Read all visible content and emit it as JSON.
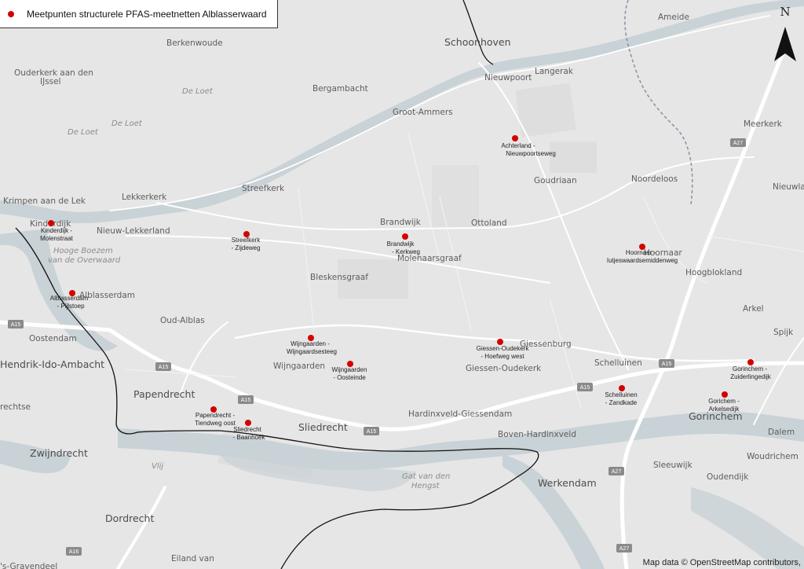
{
  "legend": {
    "label": "Meetpunten structurele PFAS-meetnetten Alblasserwaard",
    "marker_color": "#d40000"
  },
  "north_arrow": {
    "letter": "N"
  },
  "attribution": "Map data © OpenStreetMap contributors,",
  "colors": {
    "land": "#e6e6e6",
    "water": "#c9d2d6",
    "road": "#ffffff",
    "boundary": "#111111",
    "point": "#d40000"
  },
  "places": {
    "schoonhoven": "Schoonhoven",
    "ameide": "Ameide",
    "berkenwoude": "Berkenwoude",
    "ouderkerk": "Ouderkerk aan den",
    "ijssel": "IJssel",
    "bergambacht": "Bergambacht",
    "nieuwpoort": "Nieuwpoort",
    "langerak": "Langerak",
    "groot_ammers": "Groot-Ammers",
    "meerkerk": "Meerkerk",
    "goudriaan": "Goudriaan",
    "noordeloos": "Noordeloos",
    "nieuwland": "Nieuwland",
    "krimpen": "Krimpen aan de Lek",
    "lekkerkerk": "Lekkerkerk",
    "streefkerk": "Streefkerk",
    "kinderdijk": "Kinderdijk",
    "nieuw_lekkerland": "Nieuw-Lekkerland",
    "brandwijk": "Brandwijk",
    "ottoland": "Ottoland",
    "molenaarsgraaf": "Molenaarsgraaf",
    "hoornaar": "Hoornaar",
    "hoogblokland": "Hoogblokland",
    "bleskensgraaf": "Bleskensgraaf",
    "alblasserdam": "Alblasserdam",
    "oud_alblas": "Oud-Alblas",
    "oostendam": "Oostendam",
    "arkel": "Arkel",
    "spijk": "Spijk",
    "hendrik_ido": "Hendrik-Ido-Ambacht",
    "giessenburg": "Giessenburg",
    "giessen_oudekerk": "Giessen-Oudekerk",
    "schelluinen": "Schelluinen",
    "wijngaarden": "Wijngaarden",
    "papendrecht": "Papendrecht",
    "gorinchem": "Gorinchem",
    "hardinxveld": "Hardinxveld-Giessendam",
    "sliedrecht": "Sliedrecht",
    "boven_hardinxveld": "Boven-Hardinxveld",
    "dalem": "Dalem",
    "zwijndrecht": "Zwijndrecht",
    "woudrichem": "Woudrichem",
    "sleeuwijk": "Sleeuwijk",
    "oudendijk": "Oudendijk",
    "werkendam": "Werkendam",
    "dordrecht": "Dordrecht",
    "eiland_van": "Eiland van",
    "ravendeel": "'s-Gravendeel",
    "rechtse": "rechtse",
    "vlij": "Vlij"
  },
  "water_labels": {
    "de_loet_1": "De Loet",
    "de_loet_2": "De Loet",
    "de_loet_3": "De Loet",
    "hooge_boezem_1": "Hooge Boezem",
    "hooge_boezem_2": "van de Overwaard",
    "gat_1": "Gat van den",
    "gat_2": "Hengst"
  },
  "road_labels": {
    "a15_1": "A15",
    "a15_2": "A15",
    "a15_3": "A15",
    "a15_4": "A15",
    "a15_5": "A15",
    "a15_6": "A15",
    "a27_1": "A27",
    "a27_2": "A27",
    "a27_3": "A27",
    "a16": "A16"
  },
  "measurement_points": [
    {
      "line1": "Achterland -",
      "line2": "Nieuwpoortseweg"
    },
    {
      "line1": "Kinderdijk -",
      "line2": "Molenstraat"
    },
    {
      "line1": "Streefkerk",
      "line2": "- Zijdeweg"
    },
    {
      "line1": "Brandwijk",
      "line2": "- Kerkweg"
    },
    {
      "line1": "Hoornaar -",
      "line2": "Iutjeswaardsemiddenweg"
    },
    {
      "line1": "Alblasserdam",
      "line2": "- Pijlstoep"
    },
    {
      "line1": "Wijngaarden -",
      "line2": "Wijngaardsesteeg"
    },
    {
      "line1": "Wijngaarden",
      "line2": "- Oosteinde"
    },
    {
      "line1": "Giessen-Oudekerk",
      "line2": "- Hoefweg west"
    },
    {
      "line1": "Gorinchem -",
      "line2": "Zuiderlingedijk"
    },
    {
      "line1": "Schelluinen",
      "line2": "- Zandkade"
    },
    {
      "line1": "Gorichem -",
      "line2": "Arkelsedijk"
    },
    {
      "line1": "Papendrecht -",
      "line2": "Tiendweg oost"
    },
    {
      "line1": "Sliedrecht",
      "line2": "- Baanhoek"
    }
  ]
}
